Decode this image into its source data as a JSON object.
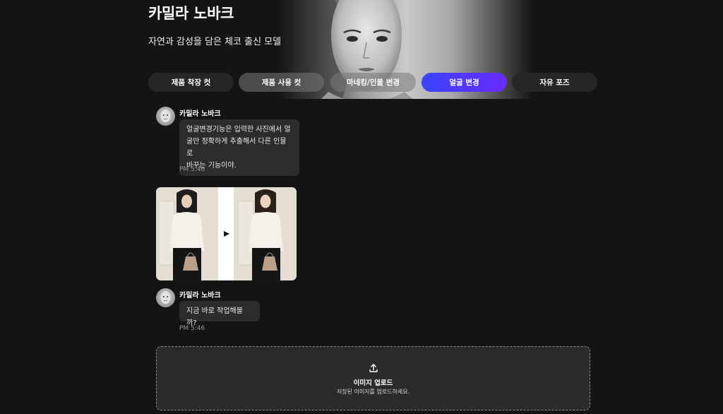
{
  "hero": {
    "title": "카밀라 노바크",
    "subtitle": "자연과 감성을 담은 체코 출신 모델"
  },
  "tabs": [
    {
      "label": "제품 착장 컷"
    },
    {
      "label": "제품 사용 컷"
    },
    {
      "label": "마네킹/인물 변경"
    },
    {
      "label": "얼굴 변경",
      "active": true
    },
    {
      "label": "자유 포즈"
    }
  ],
  "messages": [
    {
      "sender": "카밀라 노바크",
      "lines": [
        "얼굴변경기능은 입력한 사진에서 얼",
        "굴만 정확하게 추출해서 다른 인물로",
        "바꾸는 기능이야."
      ],
      "time": "PM 5:46"
    },
    {
      "sender": "카밀라 노바크",
      "text": "지금 바로 작업해볼까?",
      "time": "PM 5:46"
    }
  ],
  "upload": {
    "icon": "upload-icon",
    "title": "이미지 업로드",
    "hint": "저장된 이미지를 업로드하세요."
  },
  "colors": {
    "background": "#141414",
    "bubble": "#2c2c2c",
    "tab": "#262626",
    "active_tab_start": "#3b43ff",
    "active_tab_end": "#6a2bff"
  }
}
